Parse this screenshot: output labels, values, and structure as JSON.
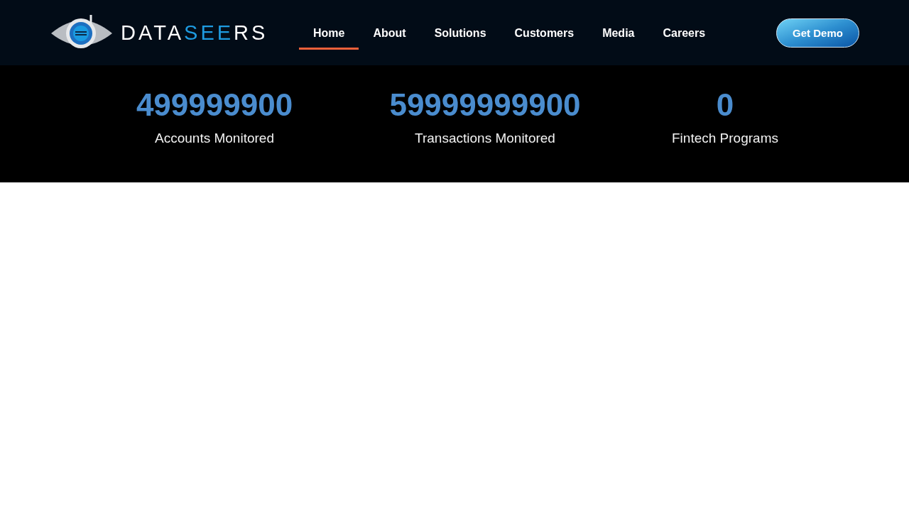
{
  "logo": {
    "parts": [
      {
        "text": "DATA",
        "accent": false
      },
      {
        "text": "SEE",
        "accent": true
      },
      {
        "text": "RS",
        "accent": false
      }
    ]
  },
  "nav": [
    {
      "label": "Home",
      "selected": true
    },
    {
      "label": "About",
      "selected": false
    },
    {
      "label": "Solutions",
      "selected": false
    },
    {
      "label": "Customers",
      "selected": false
    },
    {
      "label": "Media",
      "selected": false
    },
    {
      "label": "Careers",
      "selected": false
    }
  ],
  "cta": "Get Demo",
  "stats": [
    {
      "value": "499999900",
      "label": "Accounts Monitored"
    },
    {
      "value": "59999999900",
      "label": "Transactions Monitored"
    },
    {
      "value": "0",
      "label": "Fintech Programs"
    }
  ]
}
